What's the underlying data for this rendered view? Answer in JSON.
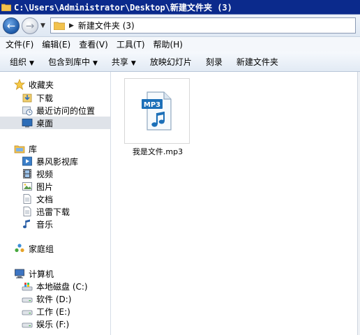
{
  "window": {
    "title": "C:\\Users\\Administrator\\Desktop\\新建文件夹 (3)"
  },
  "address": {
    "path": "新建文件夹 (3)"
  },
  "menu": [
    {
      "label": "文件(F)"
    },
    {
      "label": "编辑(E)"
    },
    {
      "label": "查看(V)"
    },
    {
      "label": "工具(T)"
    },
    {
      "label": "帮助(H)"
    }
  ],
  "toolbar": {
    "organize": "组织",
    "include_in_library": "包含到库中",
    "share": "共享",
    "slideshow": "放映幻灯片",
    "burn": "刻录",
    "new_folder": "新建文件夹"
  },
  "sidebar": {
    "favorites": "收藏夹",
    "downloads": "下载",
    "recent": "最近访问的位置",
    "desktop": "桌面",
    "libraries": "库",
    "storm_video_library": "暴风影视库",
    "videos": "视频",
    "pictures": "图片",
    "documents": "文档",
    "thunder_downloads": "迅雷下载",
    "music": "音乐",
    "homegroup": "家庭组",
    "computer": "计算机",
    "drive_c": "本地磁盘 (C:)",
    "drive_d": "软件 (D:)",
    "drive_e": "工作 (E:)",
    "drive_f": "娱乐 (F:)"
  },
  "files": [
    {
      "name": "我是文件.mp3",
      "badge": "MP3",
      "icon": "mp3-file-icon"
    }
  ]
}
